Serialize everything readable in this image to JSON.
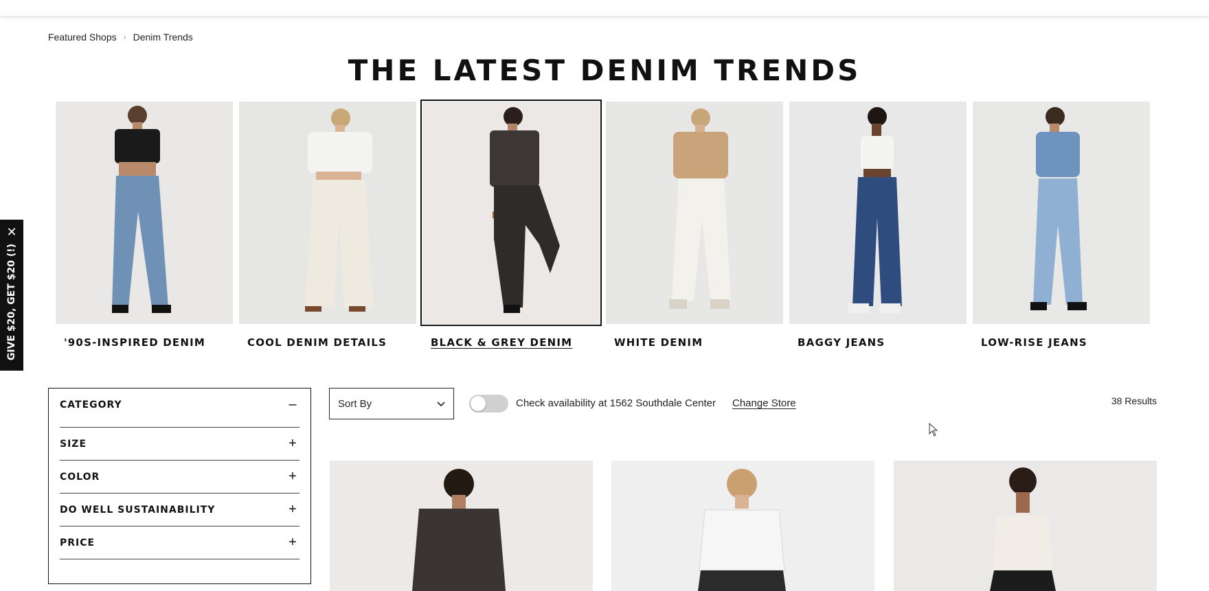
{
  "breadcrumb": {
    "items": [
      "Featured Shops",
      "Denim Trends"
    ]
  },
  "page_title": "THE LATEST DENIM TRENDS",
  "trends": [
    {
      "label": "'90S-INSPIRED DENIM",
      "selected": false
    },
    {
      "label": "COOL DENIM DETAILS",
      "selected": false
    },
    {
      "label": "BLACK & GREY DENIM",
      "selected": true
    },
    {
      "label": "WHITE DENIM",
      "selected": false
    },
    {
      "label": "BAGGY JEANS",
      "selected": false
    },
    {
      "label": "LOW-RISE JEANS",
      "selected": false
    }
  ],
  "promo": {
    "text": "GIVE $20, GET $20 (!)",
    "close": "✕"
  },
  "filters": [
    {
      "name": "CATEGORY",
      "toggle": "–",
      "expanded": true
    },
    {
      "name": "SIZE",
      "toggle": "+",
      "expanded": false
    },
    {
      "name": "COLOR",
      "toggle": "+",
      "expanded": false
    },
    {
      "name": "DO WELL SUSTAINABILITY",
      "toggle": "+",
      "expanded": false
    },
    {
      "name": "PRICE",
      "toggle": "+",
      "expanded": false
    }
  ],
  "toolbar": {
    "sort_label": "Sort By",
    "availability_text": "Check availability at 1562 Southdale Center",
    "change_store": "Change Store",
    "results": "38 Results",
    "availability_on": false
  },
  "colors": {
    "text": "#111111",
    "photo_bg": "#ececec",
    "toggle_off": "#d0d0d0"
  }
}
